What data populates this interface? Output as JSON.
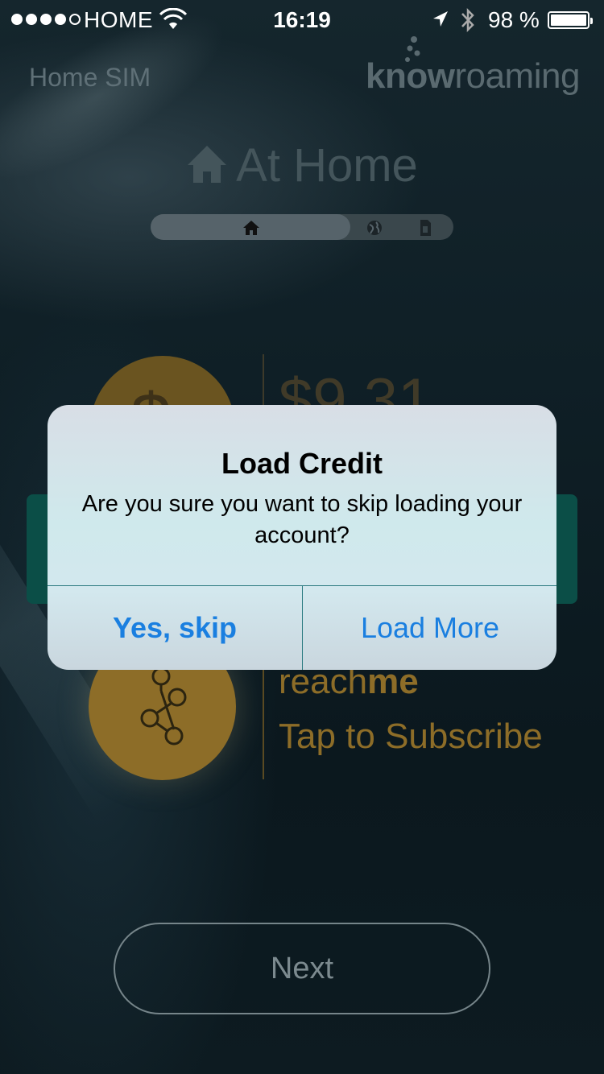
{
  "status_bar": {
    "carrier": "HOME",
    "time": "16:19",
    "battery_percent": "98 %",
    "battery_level": 0.98,
    "signal_bars_filled": 4,
    "signal_bars_total": 5
  },
  "header": {
    "sim_label": "Home SIM",
    "logo_prefix": "know",
    "logo_suffix": "roaming"
  },
  "mode": {
    "title": "At Home",
    "selected": "home",
    "options": [
      "home-icon",
      "globe-icon",
      "sim-icon"
    ]
  },
  "credit": {
    "symbol": "$",
    "value": "$9.31"
  },
  "reachme": {
    "brand_prefix": "reach",
    "brand_suffix": "me",
    "cta": "Tap to Subscribe"
  },
  "next_button": {
    "label": "Next"
  },
  "alert": {
    "title": "Load Credit",
    "message": "Are you sure you want to skip loading your account?",
    "buttons": [
      {
        "label": "Yes, skip"
      },
      {
        "label": "Load More"
      }
    ]
  },
  "colors": {
    "accent_blue": "#1a7fe0",
    "gold": "#8d6d28",
    "teal": "#0b4e47"
  }
}
